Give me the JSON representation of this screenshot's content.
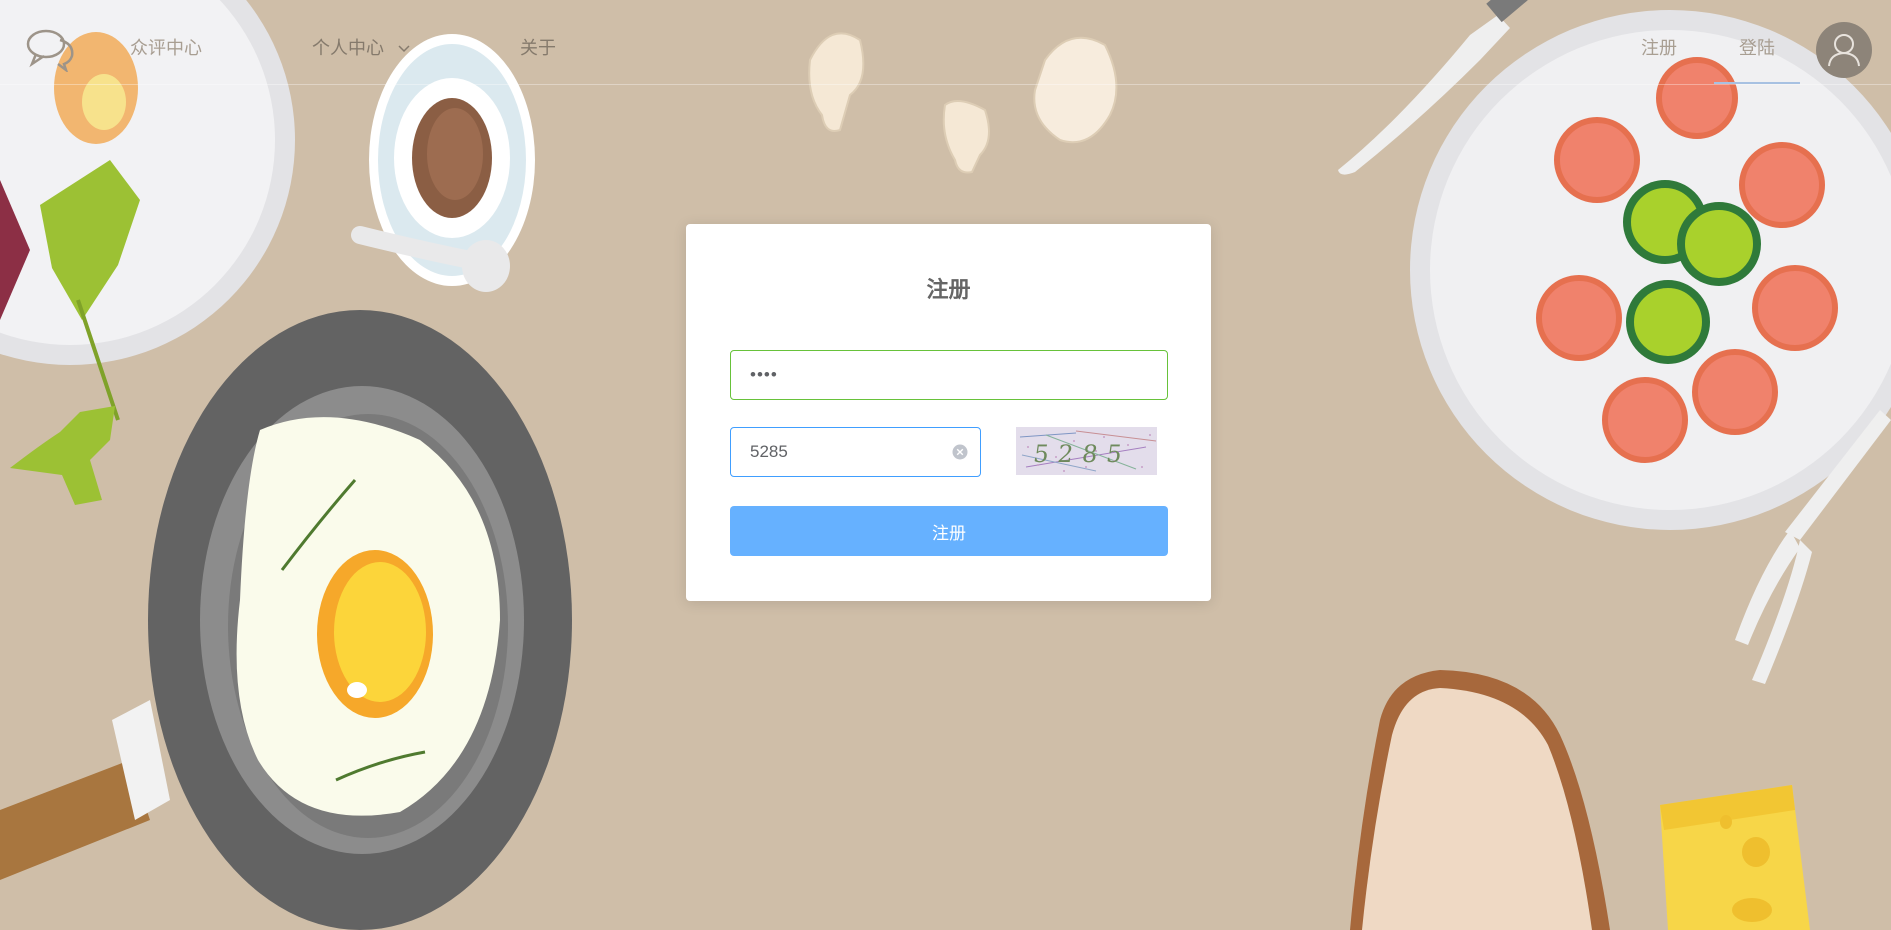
{
  "app": {
    "nav": {
      "home_label": "众评中心",
      "personal_label": "个人中心",
      "about_label": "关于",
      "register_label": "注册",
      "login_label": "登陆",
      "logo_icon": "chat-bubbles-icon",
      "avatar_icon": "user-icon"
    }
  },
  "register_form": {
    "title": "注册",
    "password_value": "••••",
    "captcha_value": "5285",
    "captcha_image_text": "5285",
    "submit_label": "注册"
  },
  "colors": {
    "background": "#cfbea8",
    "primary_button": "#66b1ff",
    "valid_border": "#67c23a",
    "focus_border": "#409eff"
  }
}
